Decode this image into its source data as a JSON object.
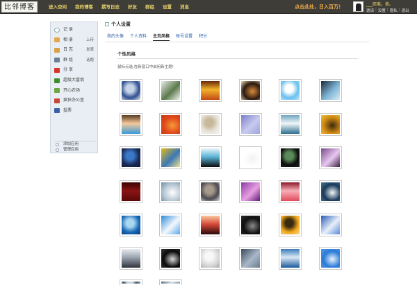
{
  "header": {
    "logo": "比邻博客",
    "nav": [
      "进入空间",
      "我的博客",
      "撰写日志",
      "好友",
      "群组",
      "设置",
      "消息"
    ],
    "slogan": "点击此处，日入百万！",
    "user_name": "___距离。美。",
    "user_links": [
      "邀请",
      "设置",
      "隐私",
      "退出"
    ]
  },
  "sidebar": {
    "items": [
      {
        "label": "记 录",
        "icon": "record-icon",
        "color": "#ffffff"
      },
      {
        "label": "相 册",
        "action": "上传",
        "icon": "photo-icon",
        "color": "#e2a94c"
      },
      {
        "label": "日 志",
        "action": "发表",
        "icon": "journal-icon",
        "color": "#d9a24a"
      },
      {
        "label": "群 组",
        "action": "话题",
        "icon": "group-icon",
        "color": "#6b7f96"
      },
      {
        "label": "分 享",
        "icon": "share-icon",
        "color": "#d8342b"
      },
      {
        "label": "超级大富翁",
        "icon": "monopoly-icon",
        "color": "#3d8f2e"
      },
      {
        "label": "开心农场",
        "icon": "farm-icon",
        "color": "#6ea640"
      },
      {
        "label": "疯狂办公室",
        "icon": "office-icon",
        "color": "#c8453a"
      },
      {
        "label": "投票",
        "icon": "vote-icon",
        "color": "#3b5fa8"
      }
    ],
    "bottom": [
      "添加应用",
      "管理应用"
    ]
  },
  "main": {
    "title": "个人设置",
    "tabs": [
      "我的头像",
      "个人资料",
      "主页风格",
      "账号设置",
      "积分"
    ],
    "active_tab": 2,
    "section_title": "个性风格",
    "hint": "鼠标点选,在新窗口中启用新主题!"
  },
  "themes": [
    [
      "#2f4f8f",
      "#c7d4e8",
      "#e7ebf2"
    ],
    [
      "#e8ece6",
      "#5b7a4c",
      "#f4f6f2"
    ],
    [
      "#c24a15",
      "#f2b22b",
      "#6b2a0a"
    ],
    [
      "#2a1a12",
      "#d98a3a",
      "#f6d9b0"
    ],
    [
      "#6ac0ee",
      "#ffffff",
      "#bfe6fb"
    ],
    [
      "#1b2a3a",
      "#7fb4d4",
      "#d8ecf6"
    ],
    [
      "#3a9ad8",
      "#f4c89a",
      "#5a3a22"
    ],
    [
      "#e0481c",
      "#f59a3a",
      "#c23a10"
    ],
    [
      "#e8e4dc",
      "#c8b89a",
      "#f7f3ec"
    ],
    [
      "#7a7ec8",
      "#c8cbee",
      "#9da2dc"
    ],
    [
      "#2c6f8f",
      "#f2f6f8",
      "#6fa6c0"
    ],
    [
      "#d08a12",
      "#3a2a10",
      "#f2c24a"
    ],
    [
      "#1a2a55",
      "#3b78c8",
      "#0d1a38"
    ],
    [
      "#e2b81a",
      "#3a78b8",
      "#f6e28a"
    ],
    [
      "#0a0a0a",
      "#5ab4d8",
      "#e8f4f8"
    ],
    [
      "#ffffff",
      "#f2f2f2",
      "#ffffff"
    ],
    [
      "#0d0d0d",
      "#5a8a5a",
      "#222222"
    ],
    [
      "#7a4a8a",
      "#e8c8f0",
      "#3a2040"
    ],
    [
      "#5a0808",
      "#8a1414",
      "#3a0404"
    ],
    [
      "#b8c8d4",
      "#ffffff",
      "#6a8aa0"
    ],
    [
      "#4a4a52",
      "#a89a8a",
      "#e0dad0"
    ],
    [
      "#8a3aa8",
      "#e8a0e0",
      "#5a1a7a"
    ],
    [
      "#e04a5a",
      "#f8b0b8",
      "#8a1a2a"
    ],
    [
      "#1a3a5a",
      "#f2f6fa",
      "#4a7a9a"
    ],
    [
      "#1a6ab8",
      "#a8d8f0",
      "#0a3a7a"
    ],
    [
      "#2a8ad8",
      "#f4f8fc",
      "#5aa8e8"
    ],
    [
      "#2a0a0a",
      "#d84a3a",
      "#f8c8a0"
    ],
    [
      "#101010",
      "#8a8a8a",
      "#2a2a2a"
    ],
    [
      "#f0a81a",
      "#3a2a10",
      "#f8d88a"
    ],
    [
      "#2a5ab8",
      "#e8f0fa",
      "#5a8ad8"
    ],
    [
      "#30343a",
      "#9aa4b0",
      "#e8ecf0"
    ],
    [
      "#0a0a0a",
      "#d8d8d8",
      "#3a3a3a"
    ],
    [
      "#d8d8d8",
      "#f8f8f8",
      "#a8a8a8"
    ],
    [
      "#3a4a5a",
      "#a8b8c8",
      "#6a7a8a"
    ],
    [
      "#1a5a9a",
      "#d8e8f4",
      "#3a7ab8"
    ],
    [
      "#2a7ad8",
      "#e8f4fc",
      "#5a9ae8"
    ],
    [
      "#4a5a6a",
      "#c8d4e0",
      "#8a9aaa"
    ],
    [
      "#5a6a7a",
      "#d8e0e8",
      "#8a9aaa"
    ]
  ]
}
